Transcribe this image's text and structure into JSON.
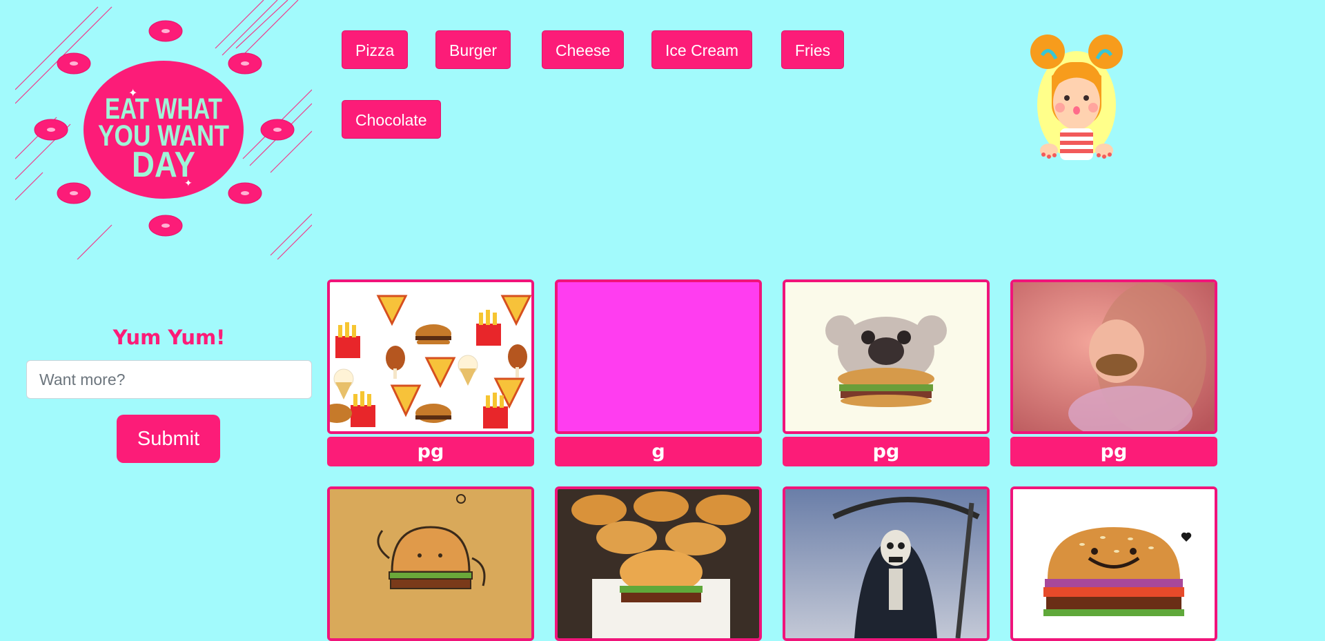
{
  "logo": {
    "text_lines": [
      "EAT WHAT",
      "YOU WANT",
      "DAY"
    ],
    "icon": "donut-icon",
    "colors": {
      "circle": "#fc1c78",
      "text": "#9ff5d8",
      "stripes": "#fc1c78"
    }
  },
  "topics": {
    "pizza": "Pizza",
    "burger": "Burger",
    "cheese": "Cheese",
    "ice_cream": "Ice Cream",
    "fries": "Fries",
    "chocolate": "Chocolate"
  },
  "mascot": {
    "icon": "girl-mascot-icon"
  },
  "form": {
    "title": "Yum Yum!",
    "input_value": "",
    "input_placeholder": "Want more?",
    "submit_label": "Submit"
  },
  "gifs": [
    {
      "caption": "pg",
      "image": "food-pattern-image"
    },
    {
      "caption": "g",
      "image": "magenta-blank-image"
    },
    {
      "caption": "pg",
      "image": "koala-burger-image"
    },
    {
      "caption": "pg",
      "image": "girl-eating-burger-image"
    },
    {
      "caption": "",
      "image": "cartoon-burger-image"
    },
    {
      "caption": "",
      "image": "burgers-tray-image"
    },
    {
      "caption": "",
      "image": "grim-reaper-image"
    },
    {
      "caption": "",
      "image": "smiling-burger-image"
    }
  ],
  "colors": {
    "background": "#a2fafc",
    "accent": "#fc1c78",
    "card_border": "#f0147a",
    "magenta_tile": "#ff3df0"
  }
}
